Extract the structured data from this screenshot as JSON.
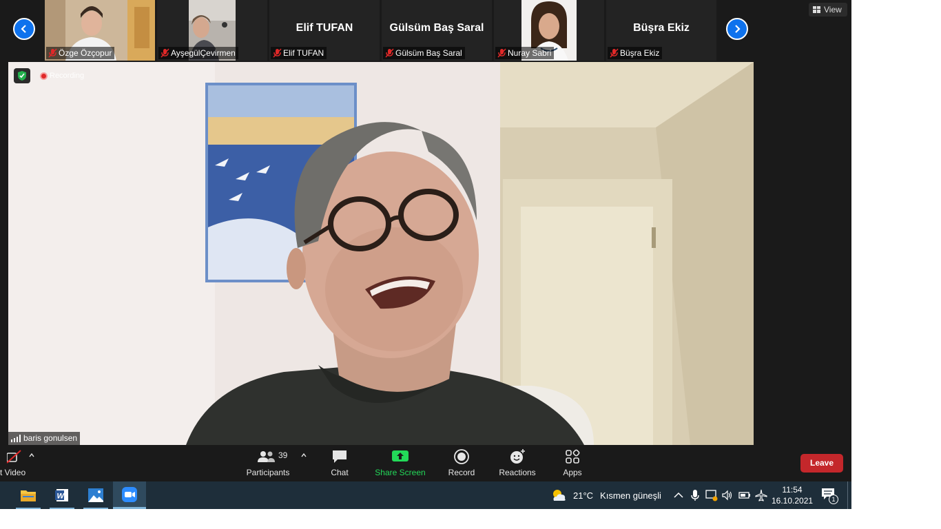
{
  "strip": {
    "participants": [
      {
        "name": "Özge Özçopur",
        "type": "video"
      },
      {
        "name": "AyşegülÇevirmen",
        "type": "video"
      },
      {
        "name": "Elif TUFAN",
        "type": "name"
      },
      {
        "name": "Gülsüm Baş Saral",
        "type": "name"
      },
      {
        "name": "Nuray Sabri",
        "type": "video"
      },
      {
        "name": "Büşra Ekiz",
        "type": "name"
      }
    ],
    "view_label": "View"
  },
  "main": {
    "recording_label": "Recording",
    "speaker_name": "baris gonulsen"
  },
  "toolbar": {
    "video_label": "t Video",
    "participants_count": "39",
    "participants_label": "Participants",
    "chat_label": "Chat",
    "share_label": "Share Screen",
    "record_label": "Record",
    "reactions_label": "Reactions",
    "apps_label": "Apps",
    "leave_label": "Leave"
  },
  "taskbar": {
    "weather_temp": "21°C",
    "weather_text": "Kısmen güneşli",
    "time": "11:54",
    "date": "16.10.2021",
    "notification_count": "1"
  },
  "colors": {
    "accent": "#0e72ed",
    "share_green": "#23d959",
    "leave_red": "#c4272b",
    "taskbar": "#1e2e3a"
  }
}
